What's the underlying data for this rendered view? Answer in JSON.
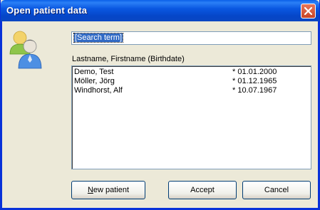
{
  "window": {
    "title": "Open patient data"
  },
  "search": {
    "value": "[Search term]"
  },
  "list": {
    "header": "Lastname, Firstname (Birthdate)",
    "rows": [
      {
        "name": "Demo, Test",
        "birthdate": "* 01.01.2000"
      },
      {
        "name": "Möller, Jörg",
        "birthdate": "* 01.12.1965"
      },
      {
        "name": "Windhorst, Alf",
        "birthdate": "* 10.07.1967"
      }
    ]
  },
  "buttons": {
    "new_patient_mnemonic": "N",
    "new_patient_rest": "ew patient",
    "accept": "Accept",
    "cancel": "Cancel"
  },
  "icons": {
    "close": "close-icon",
    "avatar": "patients-avatar-icon"
  }
}
